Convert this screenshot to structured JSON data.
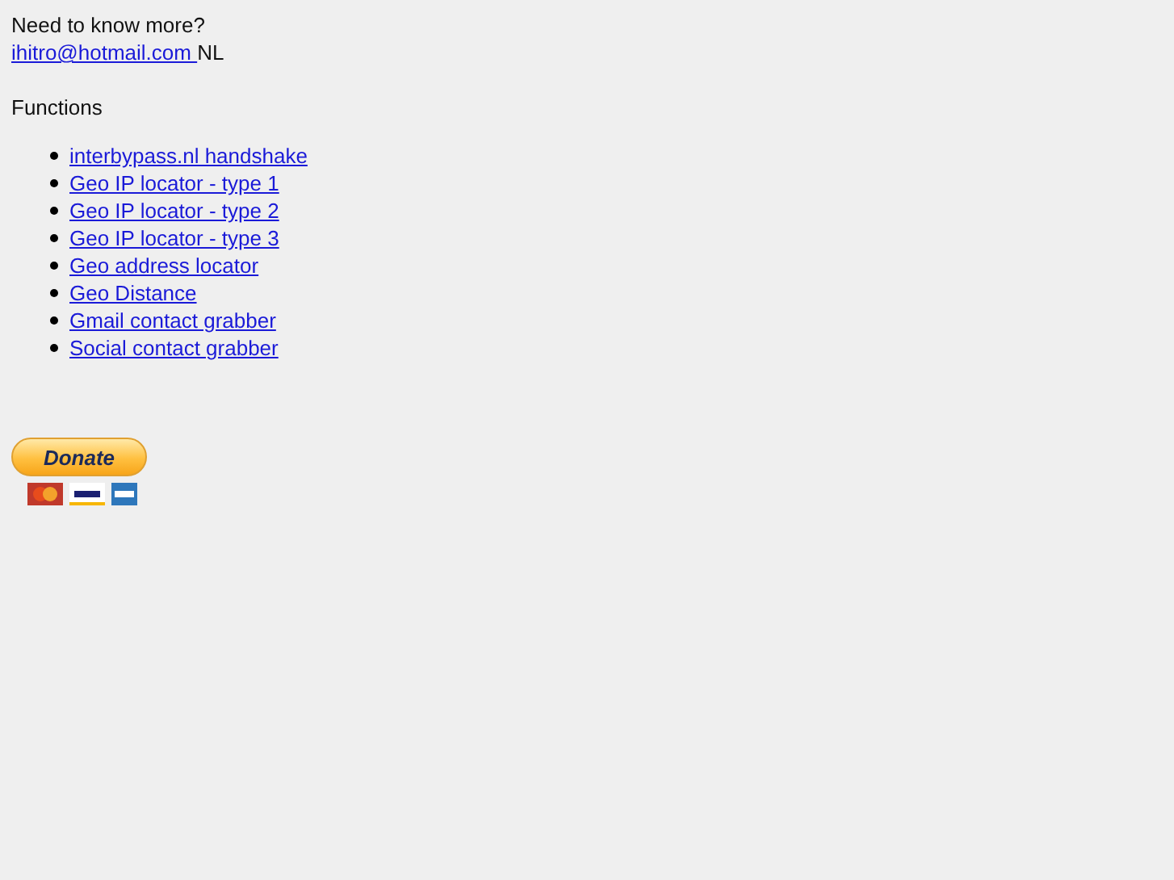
{
  "contact": {
    "heading": "Need to know more?",
    "email": "ihitro@hotmail.com ",
    "country": "NL"
  },
  "functions": {
    "heading": "Functions",
    "items": [
      "interbypass.nl handshake",
      "Geo IP locator - type 1",
      "Geo IP locator - type 2",
      "Geo IP locator - type 3",
      "Geo address locator",
      "Geo Distance",
      "Gmail contact grabber",
      "Social contact grabber"
    ]
  },
  "donate": {
    "label": "Donate"
  }
}
